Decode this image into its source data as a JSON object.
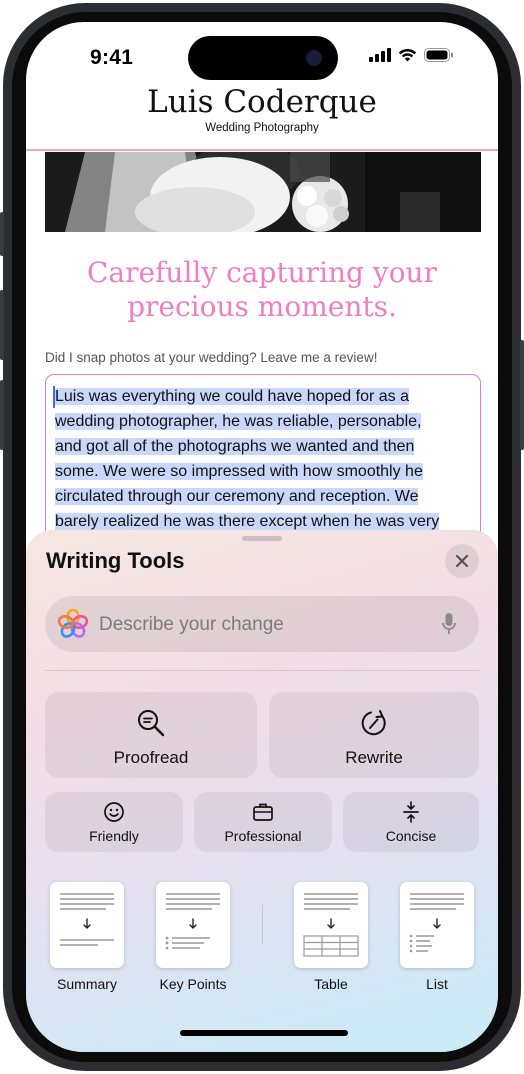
{
  "status_bar": {
    "time": "9:41"
  },
  "site": {
    "title": "Luis Coderque",
    "subtitle": "Wedding Photography",
    "headline_line1": "Carefully capturing your",
    "headline_line2": "precious moments.",
    "review_prompt": "Did I snap photos at your wedding? Leave me a review!",
    "review_lines": [
      "Luis was everything we could have hoped for as a",
      "wedding photographer, he was reliable, personable,",
      "and got all of the photographs we wanted and then",
      "some. We were so impressed with how smoothly he",
      "circulated through our ceremony and reception. We",
      "barely realized he was there except when he was very"
    ]
  },
  "writing_tools": {
    "title": "Writing Tools",
    "close_icon": "xmark-icon",
    "describe_placeholder": "Describe your change",
    "actions_large": [
      {
        "label": "Proofread",
        "icon": "magnifier-check-icon"
      },
      {
        "label": "Rewrite",
        "icon": "rewrite-cycle-icon"
      }
    ],
    "actions_small": [
      {
        "label": "Friendly",
        "icon": "smiley-icon"
      },
      {
        "label": "Professional",
        "icon": "briefcase-icon"
      },
      {
        "label": "Concise",
        "icon": "compress-icon"
      }
    ],
    "formats": [
      {
        "label": "Summary",
        "icon": "summary-doc-icon"
      },
      {
        "label": "Key Points",
        "icon": "key-points-doc-icon"
      },
      {
        "label": "Table",
        "icon": "table-doc-icon"
      },
      {
        "label": "List",
        "icon": "list-doc-icon"
      }
    ]
  },
  "colors": {
    "accent_pink": "#ef7ec4",
    "selection": "#c9d7fb",
    "cursor": "#3b6ef0"
  }
}
